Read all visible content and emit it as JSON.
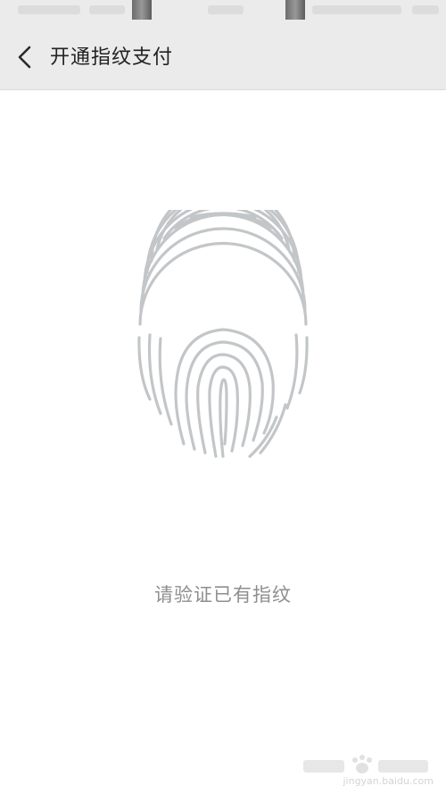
{
  "header": {
    "title": "开通指纹支付"
  },
  "main": {
    "prompt": "请验证已有指纹"
  },
  "watermark": {
    "domain": "jingyan.baidu.com"
  },
  "colors": {
    "header_bg": "#ebebeb",
    "fingerprint_stroke": "#c3c6c8",
    "prompt_text": "#8e8e8e",
    "title_text": "#222222"
  },
  "icons": {
    "back": "chevron-left-icon",
    "fingerprint": "fingerprint-icon"
  }
}
